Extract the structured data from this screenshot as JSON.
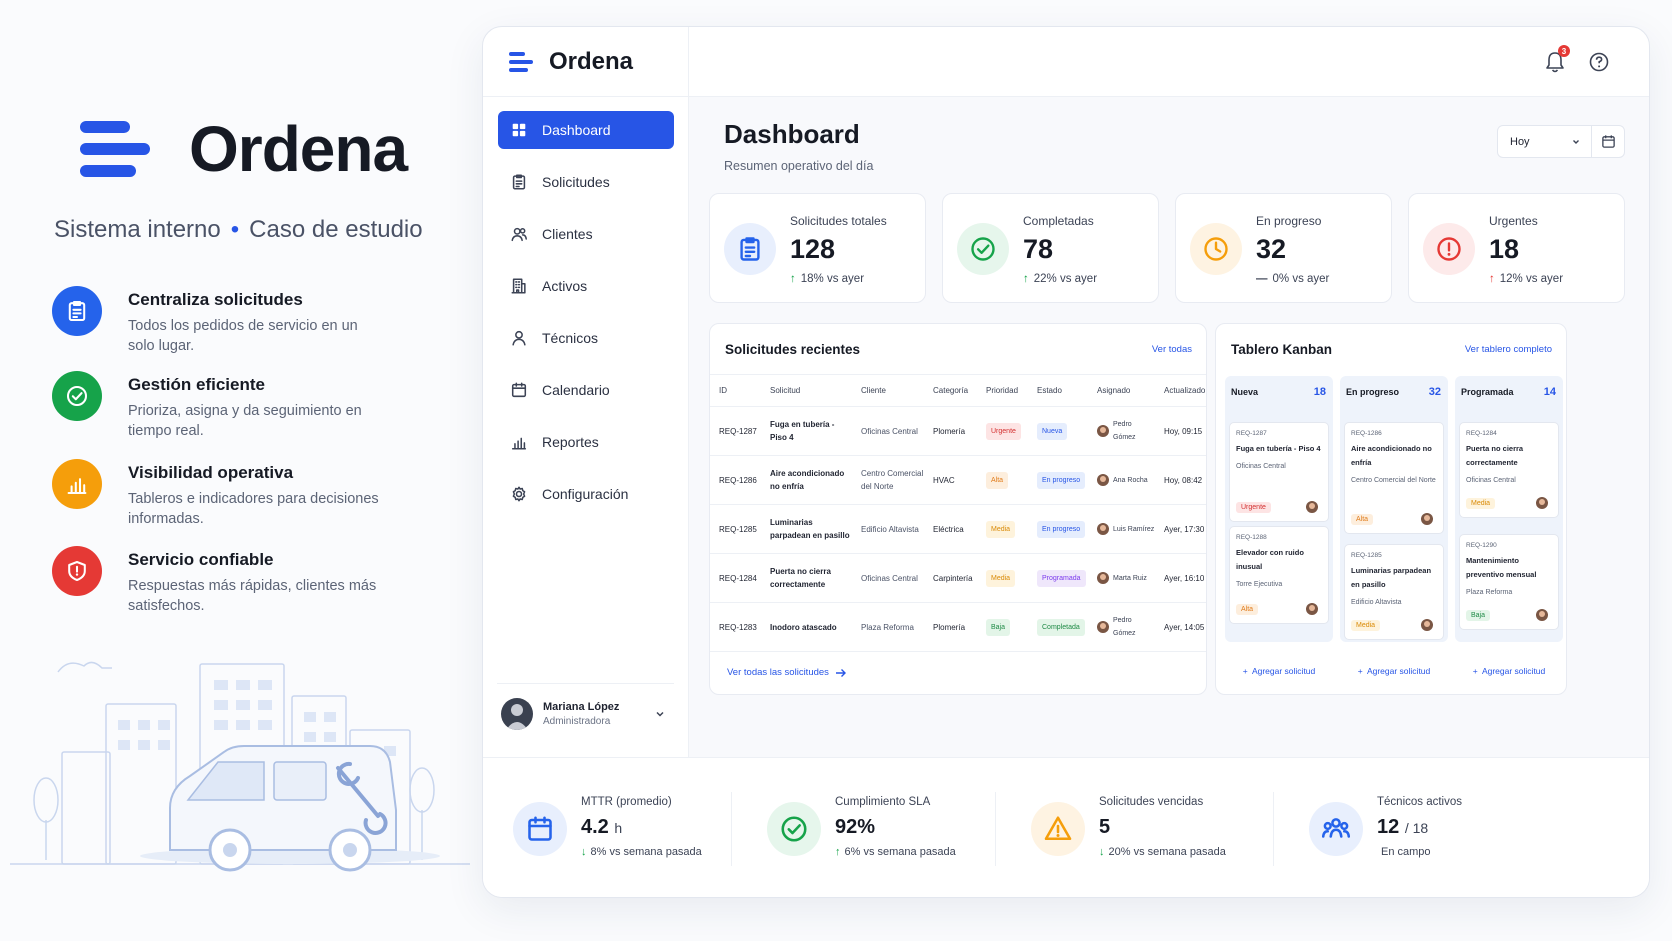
{
  "promo": {
    "brand": "Ordena",
    "subtitle_a": "Sistema interno",
    "subtitle_sep": "•",
    "subtitle_b": "Caso de estudio",
    "features": [
      {
        "title": "Centraliza solicitudes",
        "desc": "Todos los pedidos de servicio en un solo lugar.",
        "icon": "clipboard-icon",
        "color": "#2563eb"
      },
      {
        "title": "Gestión eficiente",
        "desc": "Prioriza, asigna y da seguimiento en tiempo real.",
        "icon": "check-circle-icon",
        "color": "#16a34a"
      },
      {
        "title": "Visibilidad operativa",
        "desc": "Tableros e indicadores para decisiones informadas.",
        "icon": "bar-chart-icon",
        "color": "#f59e0b"
      },
      {
        "title": "Servicio confiable",
        "desc": "Respuestas más rápidas, clientes más satisfechos.",
        "icon": "shield-alert-icon",
        "color": "#e53935"
      }
    ]
  },
  "app": {
    "brand": "Ordena",
    "accent": "#2755e6",
    "notifications_count": "3",
    "nav": [
      {
        "label": "Dashboard",
        "icon": "grid-icon",
        "active": true
      },
      {
        "label": "Solicitudes",
        "icon": "clipboard-icon"
      },
      {
        "label": "Clientes",
        "icon": "users-icon"
      },
      {
        "label": "Activos",
        "icon": "building-icon"
      },
      {
        "label": "Técnicos",
        "icon": "user-icon"
      },
      {
        "label": "Calendario",
        "icon": "calendar-icon"
      },
      {
        "label": "Reportes",
        "icon": "bar-chart-icon"
      },
      {
        "label": "Configuración",
        "icon": "gear-icon"
      }
    ],
    "user": {
      "name": "Mariana López",
      "role": "Administradora"
    },
    "header": {
      "title": "Dashboard",
      "subtitle": "Resumen operativo del día",
      "date_filter": "Hoy"
    },
    "kpis": [
      {
        "label": "Solicitudes totales",
        "value": "128",
        "delta": "18% vs ayer",
        "arrow": "↑",
        "color": "#2563eb",
        "bg": "#e8effd"
      },
      {
        "label": "Completadas",
        "value": "78",
        "delta": "22% vs ayer",
        "arrow": "↑",
        "color": "#16a34a",
        "bg": "#e6f6ec"
      },
      {
        "label": "En progreso",
        "value": "32",
        "delta": "0% vs ayer",
        "arrow": "—",
        "color": "#f59e0b",
        "bg": "#fef3e2"
      },
      {
        "label": "Urgentes",
        "value": "18",
        "delta": "12% vs ayer",
        "arrow": "↑",
        "color": "#e53935",
        "bg": "#fdeaea"
      }
    ],
    "recent": {
      "title": "Solicitudes recientes",
      "link": "Ver todas",
      "footer_link": "Ver todas las solicitudes",
      "columns": [
        "ID",
        "Solicitud",
        "Cliente",
        "Categoría",
        "Prioridad",
        "Estado",
        "Asignado",
        "Actualizado"
      ],
      "rows": [
        {
          "id": "REQ-1287",
          "solicitud": "Fuga en tubería - Piso 4",
          "cliente": "Oficinas Central",
          "categoria": "Plomería",
          "prioridad": "Urgente",
          "estado": "Nueva",
          "asignado": "Pedro Gómez",
          "actualizado": "Hoy, 09:15"
        },
        {
          "id": "REQ-1286",
          "solicitud": "Aire acondicionado no enfría",
          "cliente": "Centro Comercial del Norte",
          "categoria": "HVAC",
          "prioridad": "Alta",
          "estado": "En progreso",
          "asignado": "Ana Rocha",
          "actualizado": "Hoy, 08:42"
        },
        {
          "id": "REQ-1285",
          "solicitud": "Luminarias parpadean en pasillo",
          "cliente": "Edificio Altavista",
          "categoria": "Eléctrica",
          "prioridad": "Media",
          "estado": "En progreso",
          "asignado": "Luis Ramírez",
          "actualizado": "Ayer, 17:30"
        },
        {
          "id": "REQ-1284",
          "solicitud": "Puerta no cierra correctamente",
          "cliente": "Oficinas Central",
          "categoria": "Carpintería",
          "prioridad": "Media",
          "estado": "Programada",
          "asignado": "Marta Ruiz",
          "actualizado": "Ayer, 16:10"
        },
        {
          "id": "REQ-1283",
          "solicitud": "Inodoro atascado",
          "cliente": "Plaza Reforma",
          "categoria": "Plomería",
          "prioridad": "Baja",
          "estado": "Completada",
          "asignado": "Pedro Gómez",
          "actualizado": "Ayer, 14:05"
        }
      ]
    },
    "kanban": {
      "title": "Tablero Kanban",
      "link": "Ver tablero completo",
      "add_label": "Agregar solicitud",
      "columns": [
        {
          "name": "Nueva",
          "count": "18",
          "cards": [
            {
              "id": "REQ-1287",
              "title": "Fuga en tubería - Piso 4",
              "client": "Oficinas Central",
              "priority": "Urgente"
            },
            {
              "id": "REQ-1288",
              "title": "Elevador con ruido inusual",
              "client": "Torre Ejecutiva",
              "priority": "Alta"
            }
          ]
        },
        {
          "name": "En progreso",
          "count": "32",
          "cards": [
            {
              "id": "REQ-1286",
              "title": "Aire acondicionado no enfría",
              "client": "Centro Comercial del Norte",
              "priority": "Alta"
            },
            {
              "id": "REQ-1285",
              "title": "Luminarias parpadean en pasillo",
              "client": "Edificio Altavista",
              "priority": "Media"
            }
          ]
        },
        {
          "name": "Programada",
          "count": "14",
          "cards": [
            {
              "id": "REQ-1284",
              "title": "Puerta no cierra correctamente",
              "client": "Oficinas Central",
              "priority": "Media"
            },
            {
              "id": "REQ-1290",
              "title": "Mantenimiento preventivo mensual",
              "client": "Plaza Reforma",
              "priority": "Baja"
            }
          ]
        }
      ]
    },
    "metrics": [
      {
        "label": "MTTR (promedio)",
        "value": "4.2",
        "unit": "h",
        "delta": "8% vs semana pasada",
        "arrow": "↓",
        "color": "#2563eb",
        "bg": "#e8effd",
        "icon": "calendar-icon"
      },
      {
        "label": "Cumplimiento SLA",
        "value": "92%",
        "unit": "",
        "delta": "6% vs semana pasada",
        "arrow": "↑",
        "color": "#16a34a",
        "bg": "#e6f6ec",
        "icon": "check-circle-icon"
      },
      {
        "label": "Solicitudes vencidas",
        "value": "5",
        "unit": "",
        "delta": "20% vs semana pasada",
        "arrow": "↓",
        "color": "#f59e0b",
        "bg": "#fef3e2",
        "icon": "warning-icon"
      },
      {
        "label": "Técnicos activos",
        "value": "12",
        "unit": "/ 18",
        "delta": "En campo",
        "arrow": "",
        "color": "#2563eb",
        "bg": "#e8effd",
        "icon": "team-icon"
      }
    ],
    "pill_colors": {
      "Urgente": {
        "bg": "#fde4e4",
        "fg": "#d32f2f"
      },
      "Alta": {
        "bg": "#fdeedd",
        "fg": "#e07b1a"
      },
      "Media": {
        "bg": "#fef3dc",
        "fg": "#d98a06"
      },
      "Baja": {
        "bg": "#e3f5e8",
        "fg": "#1f8a46"
      },
      "Nueva": {
        "bg": "#e5edfd",
        "fg": "#2755e6"
      },
      "En progreso": {
        "bg": "#e5edfd",
        "fg": "#2755e6"
      },
      "Programada": {
        "bg": "#efe7fb",
        "fg": "#7c3aed"
      },
      "Completada": {
        "bg": "#e3f5e8",
        "fg": "#1f8a46"
      }
    }
  }
}
